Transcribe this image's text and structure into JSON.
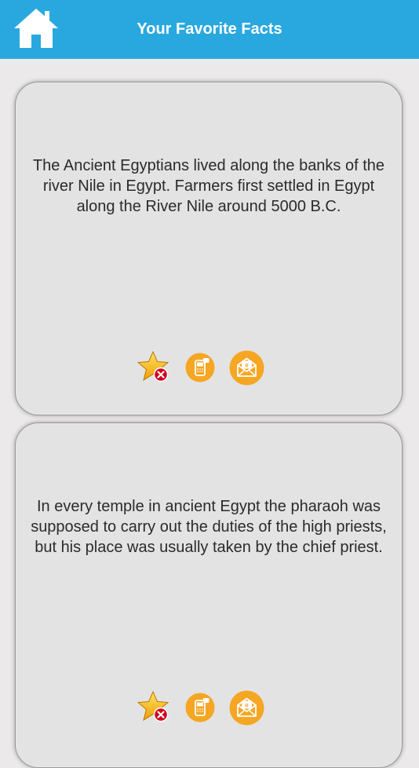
{
  "header": {
    "title": "Your Favorite Facts",
    "home_icon": "home-icon"
  },
  "colors": {
    "header_bg": "#29a8e0",
    "page_bg": "#ebe9e9",
    "card_bg": "#e3e3e3",
    "action_orange": "#f5a623",
    "remove_red": "#d0021b"
  },
  "facts": [
    {
      "text": "The Ancient Egyptians lived along the banks of the river Nile in Egypt. Farmers first settled in Egypt along the River Nile around 5000 B.C.",
      "actions": [
        "remove-favorite-icon",
        "sms-share-icon",
        "email-share-icon"
      ]
    },
    {
      "text": "In every temple in ancient Egypt the pharaoh was supposed to carry out the duties of the high priests, but his place was usually taken by the chief priest.",
      "actions": [
        "remove-favorite-icon",
        "sms-share-icon",
        "email-share-icon"
      ]
    }
  ]
}
